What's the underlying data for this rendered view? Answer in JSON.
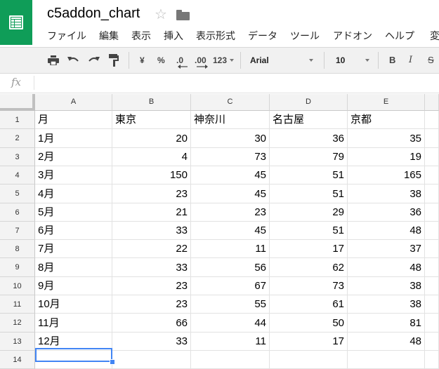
{
  "doc": {
    "title": "c5addon_chart"
  },
  "menu": [
    "ファイル",
    "編集",
    "表示",
    "挿入",
    "表示形式",
    "データ",
    "ツール",
    "アドオン",
    "ヘルプ",
    "変"
  ],
  "toolbar": {
    "currency": "¥",
    "percent": "%",
    "dec_less": ".0",
    "dec_more": ".00",
    "more_formats": "123",
    "font": "Arial",
    "font_size": "10",
    "bold": "B",
    "italic": "I",
    "strike": "S"
  },
  "formula_bar": {
    "fx_label": "fx"
  },
  "grid": {
    "columns": [
      "A",
      "B",
      "C",
      "D",
      "E"
    ],
    "row_numbers": [
      "1",
      "2",
      "3",
      "4",
      "5",
      "6",
      "7",
      "8",
      "9",
      "10",
      "11",
      "12",
      "13",
      "14"
    ],
    "rows": [
      [
        "月",
        "東京",
        "神奈川",
        "名古屋",
        "京都"
      ],
      [
        "1月",
        "20",
        "30",
        "36",
        "35"
      ],
      [
        "2月",
        "4",
        "73",
        "79",
        "19"
      ],
      [
        "3月",
        "150",
        "45",
        "51",
        "165"
      ],
      [
        "4月",
        "23",
        "45",
        "51",
        "38"
      ],
      [
        "5月",
        "21",
        "23",
        "29",
        "36"
      ],
      [
        "6月",
        "33",
        "45",
        "51",
        "48"
      ],
      [
        "7月",
        "22",
        "11",
        "17",
        "37"
      ],
      [
        "8月",
        "33",
        "56",
        "62",
        "48"
      ],
      [
        "9月",
        "23",
        "67",
        "73",
        "38"
      ],
      [
        "10月",
        "23",
        "55",
        "61",
        "38"
      ],
      [
        "11月",
        "66",
        "44",
        "50",
        "81"
      ],
      [
        "12月",
        "33",
        "11",
        "17",
        "48"
      ],
      [
        "",
        "",
        "",
        "",
        ""
      ]
    ],
    "selected_cell": "A14"
  },
  "colors": {
    "brand": "#0F9D58",
    "selection": "#4285f4"
  }
}
